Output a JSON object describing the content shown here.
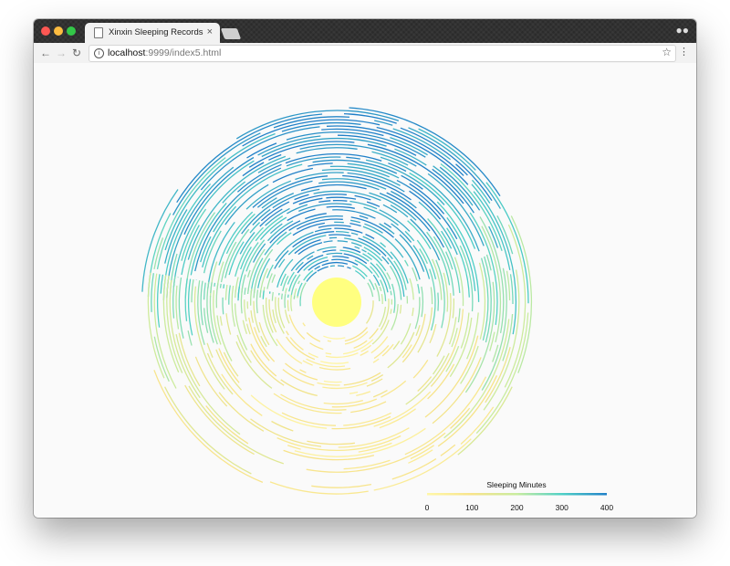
{
  "browser": {
    "tab_title": "Xinxin Sleeping Records",
    "tab_close": "×",
    "url_host": "localhost",
    "url_rest": ":9999/index5.html",
    "nav": {
      "back": "←",
      "forward": "→",
      "reload": "↻"
    },
    "star": "☆",
    "menu": "⋮"
  },
  "colors": {
    "low": "#fff7a8",
    "mid_low": "#f7e38a",
    "mid": "#c8ec9f",
    "mid_high": "#4fd0c6",
    "high": "#2080c8"
  },
  "chart_data": {
    "type": "radial-arcs",
    "description_of_encoding": "",
    "legend": {
      "title": "Sleeping Minutes",
      "ticks": [
        0,
        100,
        200,
        300,
        400
      ],
      "domain": [
        0,
        400
      ]
    },
    "center_label": ""
  }
}
